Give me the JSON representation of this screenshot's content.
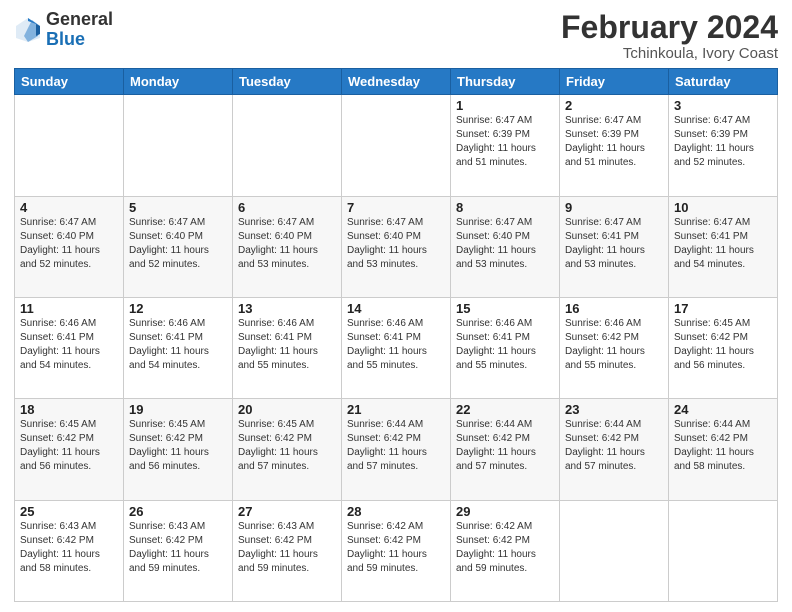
{
  "logo": {
    "general": "General",
    "blue": "Blue"
  },
  "header": {
    "title": "February 2024",
    "subtitle": "Tchinkoula, Ivory Coast"
  },
  "weekdays": [
    "Sunday",
    "Monday",
    "Tuesday",
    "Wednesday",
    "Thursday",
    "Friday",
    "Saturday"
  ],
  "rows": [
    [
      {
        "day": "",
        "info": ""
      },
      {
        "day": "",
        "info": ""
      },
      {
        "day": "",
        "info": ""
      },
      {
        "day": "",
        "info": ""
      },
      {
        "day": "1",
        "info": "Sunrise: 6:47 AM\nSunset: 6:39 PM\nDaylight: 11 hours and 51 minutes."
      },
      {
        "day": "2",
        "info": "Sunrise: 6:47 AM\nSunset: 6:39 PM\nDaylight: 11 hours and 51 minutes."
      },
      {
        "day": "3",
        "info": "Sunrise: 6:47 AM\nSunset: 6:39 PM\nDaylight: 11 hours and 52 minutes."
      }
    ],
    [
      {
        "day": "4",
        "info": "Sunrise: 6:47 AM\nSunset: 6:40 PM\nDaylight: 11 hours and 52 minutes."
      },
      {
        "day": "5",
        "info": "Sunrise: 6:47 AM\nSunset: 6:40 PM\nDaylight: 11 hours and 52 minutes."
      },
      {
        "day": "6",
        "info": "Sunrise: 6:47 AM\nSunset: 6:40 PM\nDaylight: 11 hours and 53 minutes."
      },
      {
        "day": "7",
        "info": "Sunrise: 6:47 AM\nSunset: 6:40 PM\nDaylight: 11 hours and 53 minutes."
      },
      {
        "day": "8",
        "info": "Sunrise: 6:47 AM\nSunset: 6:40 PM\nDaylight: 11 hours and 53 minutes."
      },
      {
        "day": "9",
        "info": "Sunrise: 6:47 AM\nSunset: 6:41 PM\nDaylight: 11 hours and 53 minutes."
      },
      {
        "day": "10",
        "info": "Sunrise: 6:47 AM\nSunset: 6:41 PM\nDaylight: 11 hours and 54 minutes."
      }
    ],
    [
      {
        "day": "11",
        "info": "Sunrise: 6:46 AM\nSunset: 6:41 PM\nDaylight: 11 hours and 54 minutes."
      },
      {
        "day": "12",
        "info": "Sunrise: 6:46 AM\nSunset: 6:41 PM\nDaylight: 11 hours and 54 minutes."
      },
      {
        "day": "13",
        "info": "Sunrise: 6:46 AM\nSunset: 6:41 PM\nDaylight: 11 hours and 55 minutes."
      },
      {
        "day": "14",
        "info": "Sunrise: 6:46 AM\nSunset: 6:41 PM\nDaylight: 11 hours and 55 minutes."
      },
      {
        "day": "15",
        "info": "Sunrise: 6:46 AM\nSunset: 6:41 PM\nDaylight: 11 hours and 55 minutes."
      },
      {
        "day": "16",
        "info": "Sunrise: 6:46 AM\nSunset: 6:42 PM\nDaylight: 11 hours and 55 minutes."
      },
      {
        "day": "17",
        "info": "Sunrise: 6:45 AM\nSunset: 6:42 PM\nDaylight: 11 hours and 56 minutes."
      }
    ],
    [
      {
        "day": "18",
        "info": "Sunrise: 6:45 AM\nSunset: 6:42 PM\nDaylight: 11 hours and 56 minutes."
      },
      {
        "day": "19",
        "info": "Sunrise: 6:45 AM\nSunset: 6:42 PM\nDaylight: 11 hours and 56 minutes."
      },
      {
        "day": "20",
        "info": "Sunrise: 6:45 AM\nSunset: 6:42 PM\nDaylight: 11 hours and 57 minutes."
      },
      {
        "day": "21",
        "info": "Sunrise: 6:44 AM\nSunset: 6:42 PM\nDaylight: 11 hours and 57 minutes."
      },
      {
        "day": "22",
        "info": "Sunrise: 6:44 AM\nSunset: 6:42 PM\nDaylight: 11 hours and 57 minutes."
      },
      {
        "day": "23",
        "info": "Sunrise: 6:44 AM\nSunset: 6:42 PM\nDaylight: 11 hours and 57 minutes."
      },
      {
        "day": "24",
        "info": "Sunrise: 6:44 AM\nSunset: 6:42 PM\nDaylight: 11 hours and 58 minutes."
      }
    ],
    [
      {
        "day": "25",
        "info": "Sunrise: 6:43 AM\nSunset: 6:42 PM\nDaylight: 11 hours and 58 minutes."
      },
      {
        "day": "26",
        "info": "Sunrise: 6:43 AM\nSunset: 6:42 PM\nDaylight: 11 hours and 59 minutes."
      },
      {
        "day": "27",
        "info": "Sunrise: 6:43 AM\nSunset: 6:42 PM\nDaylight: 11 hours and 59 minutes."
      },
      {
        "day": "28",
        "info": "Sunrise: 6:42 AM\nSunset: 6:42 PM\nDaylight: 11 hours and 59 minutes."
      },
      {
        "day": "29",
        "info": "Sunrise: 6:42 AM\nSunset: 6:42 PM\nDaylight: 11 hours and 59 minutes."
      },
      {
        "day": "",
        "info": ""
      },
      {
        "day": "",
        "info": ""
      }
    ]
  ]
}
